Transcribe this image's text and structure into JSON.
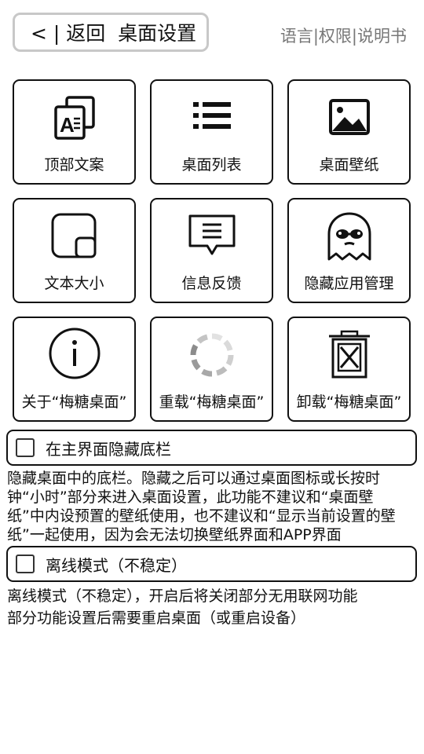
{
  "header": {
    "back_label": "< | 返回  桌面设置",
    "links": "语言|权限|说明书"
  },
  "tiles": [
    {
      "label": "顶部文案",
      "icon": "text-card-icon"
    },
    {
      "label": "桌面列表",
      "icon": "list-icon"
    },
    {
      "label": "桌面壁纸",
      "icon": "image-icon"
    },
    {
      "label": "文本大小",
      "icon": "text-size-icon"
    },
    {
      "label": "信息反馈",
      "icon": "message-icon"
    },
    {
      "label": "隐藏应用管理",
      "icon": "ghost-icon"
    },
    {
      "label": "关于“梅糖桌面”",
      "icon": "info-icon"
    },
    {
      "label": "重载“梅糖桌面”",
      "icon": "loading-spinner-icon"
    },
    {
      "label": "卸载“梅糖桌面”",
      "icon": "trash-icon"
    }
  ],
  "options": [
    {
      "label": "在主界面隐藏底栏",
      "checked": false,
      "description": [
        "隐藏桌面中的底栏。隐藏之后可以通过桌面图标或长按时",
        "钟“小时”部分来进入桌面设置，此功能不建议和“桌面壁",
        "纸”中内设预置的壁纸使用，也不建议和“显示当前设置的壁",
        "纸”一起使用，因为会无法切换壁纸界面和APP界面"
      ]
    },
    {
      "label": "离线模式（不稳定）",
      "checked": false,
      "description": [
        "离线模式（不稳定），开启后将关闭部分无用联网功能",
        "部分功能设置后需要重启桌面（或重启设备）"
      ]
    }
  ]
}
